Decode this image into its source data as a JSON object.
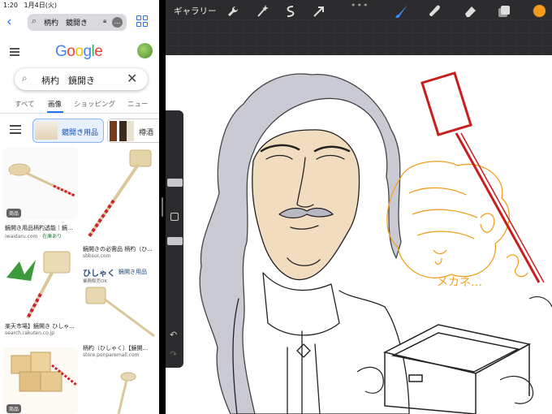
{
  "status": {
    "time": "1:20",
    "date": "1月4日(火)"
  },
  "safari": {
    "url_text": "柄杓　鏡開き"
  },
  "google": {
    "logo": [
      {
        "ch": "G",
        "color": "#4285f4"
      },
      {
        "ch": "o",
        "color": "#ea4335"
      },
      {
        "ch": "o",
        "color": "#fbbc05"
      },
      {
        "ch": "g",
        "color": "#4285f4"
      },
      {
        "ch": "l",
        "color": "#34a853"
      },
      {
        "ch": "e",
        "color": "#ea4335"
      }
    ],
    "query": "柄杓　鏡開き",
    "tabs": [
      "すべて",
      "画像",
      "ショッピング",
      "ニュー"
    ],
    "active_tab": "画像",
    "chips": [
      "鏡開き用品",
      "樽酒"
    ]
  },
  "results": [
    {
      "badge": "商品",
      "title": "鏡開き用品柄杓透能｜鏡...",
      "site": "iwaidaru.com",
      "stock": "在庫あり"
    },
    {
      "badge": "",
      "title": "鏡開きの必需品 柄杓（ひ...",
      "site": "sbbsur.com",
      "stock": ""
    },
    {
      "badge": "",
      "title": "楽天市場】鏡開き ひしゃ...",
      "site": "search.rakuten.co.jp",
      "stock": ""
    },
    {
      "badge": "",
      "title": "柄杓（ひしゃく）【鏡開...",
      "site": "store.ponparemall.com",
      "stock": ""
    },
    {
      "badge": "商品",
      "title": "",
      "site": "",
      "stock": ""
    },
    {
      "badge": "",
      "title": "",
      "site": "",
      "stock": ""
    }
  ],
  "ad_overlay": {
    "main": "ひしゃく",
    "tag": "鏡開き用品",
    "sub": "業務販売OK"
  },
  "procreate": {
    "gallery_label": "ギャラリー",
    "tools": [
      "wrench-icon",
      "magic-wand-icon",
      "selection-icon",
      "transform-icon"
    ],
    "right_tools": [
      "brush-icon",
      "smudge-icon",
      "eraser-icon",
      "layers-icon"
    ],
    "active_color": "#f59a1a",
    "handwriting": "メカネ…"
  }
}
